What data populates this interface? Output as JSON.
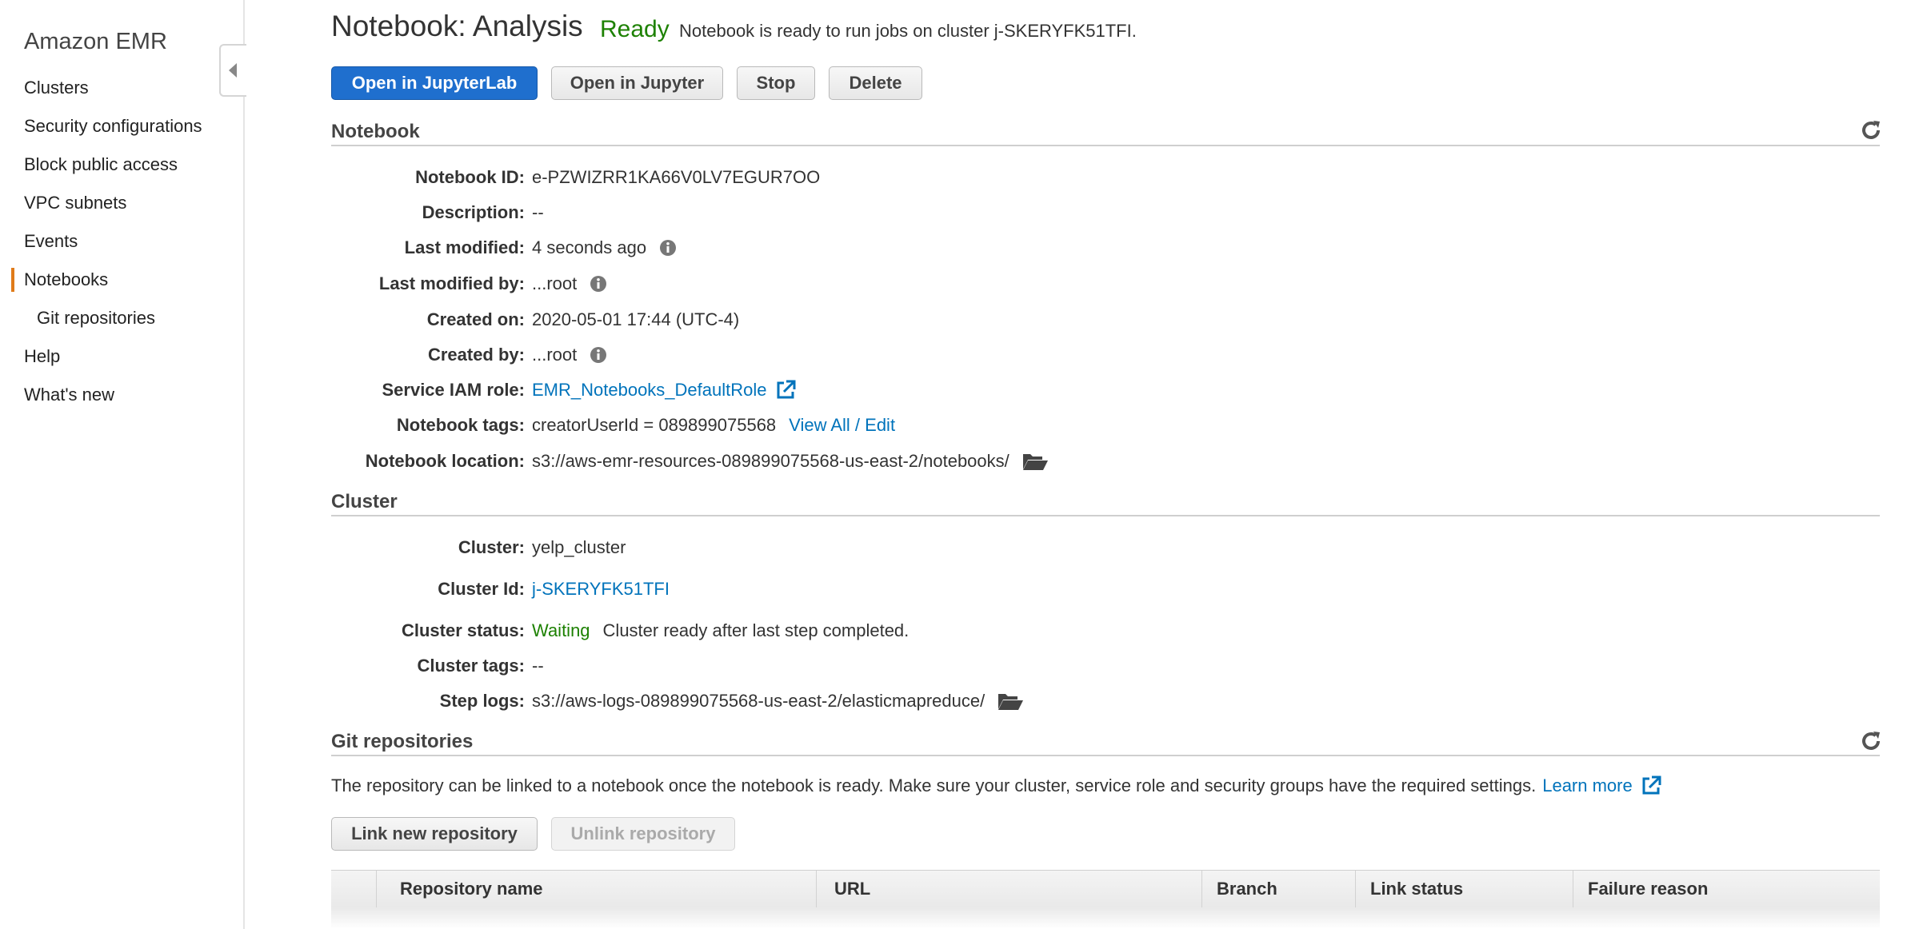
{
  "sidebar": {
    "brand": "Amazon EMR",
    "items": [
      {
        "label": "Clusters"
      },
      {
        "label": "Security configurations"
      },
      {
        "label": "Block public access"
      },
      {
        "label": "VPC subnets"
      },
      {
        "label": "Events"
      },
      {
        "label": "Notebooks",
        "active": true
      },
      {
        "label": "Git repositories",
        "sub": true
      },
      {
        "label": "Help"
      },
      {
        "label": "What's new"
      }
    ],
    "active_color": "#e07b1a"
  },
  "header": {
    "title": "Notebook: Analysis",
    "status": "Ready",
    "status_message": "Notebook is ready to run jobs on cluster j-SKERYFK51TFI.",
    "status_color": "#1d8102"
  },
  "actions": {
    "open_jupyterlab": "Open in JupyterLab",
    "open_jupyter": "Open in Jupyter",
    "stop": "Stop",
    "delete": "Delete"
  },
  "notebook": {
    "section_title": "Notebook",
    "notebook_id_label": "Notebook ID:",
    "notebook_id": "e-PZWIZRR1KA66V0LV7EGUR7OO",
    "description_label": "Description:",
    "description": "--",
    "last_modified_label": "Last modified:",
    "last_modified": "4 seconds ago",
    "last_modified_by_label": "Last modified by:",
    "last_modified_by": "...root",
    "created_on_label": "Created on:",
    "created_on": "2020-05-01 17:44 (UTC-4)",
    "created_by_label": "Created by:",
    "created_by": "...root",
    "service_role_label": "Service IAM role:",
    "service_role": "EMR_Notebooks_DefaultRole",
    "tags_label": "Notebook tags:",
    "tags": "creatorUserId = 089899075568",
    "tags_link": "View All / Edit",
    "location_label": "Notebook location:",
    "location": "s3://aws-emr-resources-089899075568-us-east-2/notebooks/"
  },
  "cluster": {
    "section_title": "Cluster",
    "cluster_label": "Cluster:",
    "cluster_name": "yelp_cluster",
    "cluster_id_label": "Cluster Id:",
    "cluster_id": "j-SKERYFK51TFI",
    "status_label": "Cluster status:",
    "status": "Waiting",
    "status_message": "Cluster ready after last step completed.",
    "tags_label": "Cluster tags:",
    "tags": "--",
    "step_logs_label": "Step logs:",
    "step_logs": "s3://aws-logs-089899075568-us-east-2/elasticmapreduce/"
  },
  "git": {
    "section_title": "Git repositories",
    "message": "The repository can be linked to a notebook once the notebook is ready. Make sure your cluster, service role and security groups have the required settings.",
    "learn_more": "Learn more",
    "link_button": "Link new repository",
    "unlink_button": "Unlink repository",
    "columns": [
      "Repository name",
      "URL",
      "Branch",
      "Link status",
      "Failure reason"
    ]
  },
  "colors": {
    "primary_button": "#1f6fce",
    "link": "#0073bb",
    "success": "#1d8102"
  }
}
